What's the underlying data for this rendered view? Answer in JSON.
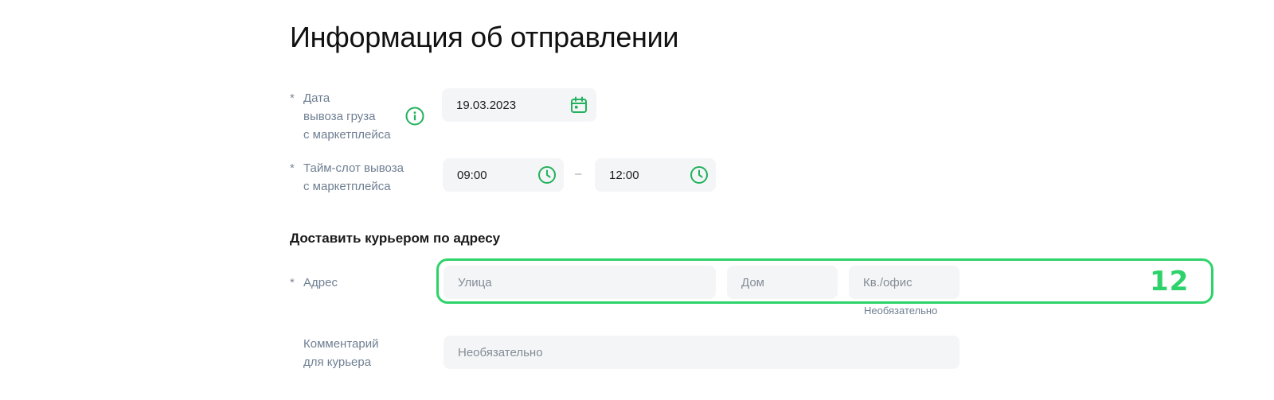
{
  "page": {
    "title": "Информация об отправлении"
  },
  "pickup_date": {
    "required_mark": "*",
    "label": "Дата\nвывоза груза\nс маркетплейса",
    "value": "19.03.2023",
    "info_icon": "info-icon",
    "calendar_icon": "calendar-icon"
  },
  "time_slot": {
    "required_mark": "*",
    "label": "Тайм-слот вывоза\nс маркетплейса",
    "from": "09:00",
    "separator": "–",
    "to": "12:00",
    "clock_icon": "clock-icon"
  },
  "delivery": {
    "section_title": "Доставить курьером по адресу",
    "address": {
      "required_mark": "*",
      "label": "Адрес",
      "street_placeholder": "Улица",
      "house_placeholder": "Дом",
      "apartment_placeholder": "Кв./офис",
      "apartment_hint": "Необязательно"
    },
    "comment": {
      "label": "Комментарий\nдля курьера",
      "placeholder": "Необязательно"
    }
  },
  "annotation": {
    "badge": "12",
    "color": "#2dd36a"
  },
  "colors": {
    "accent": "#22b15c",
    "field_bg": "#f4f5f7",
    "label": "#6f7f92"
  }
}
